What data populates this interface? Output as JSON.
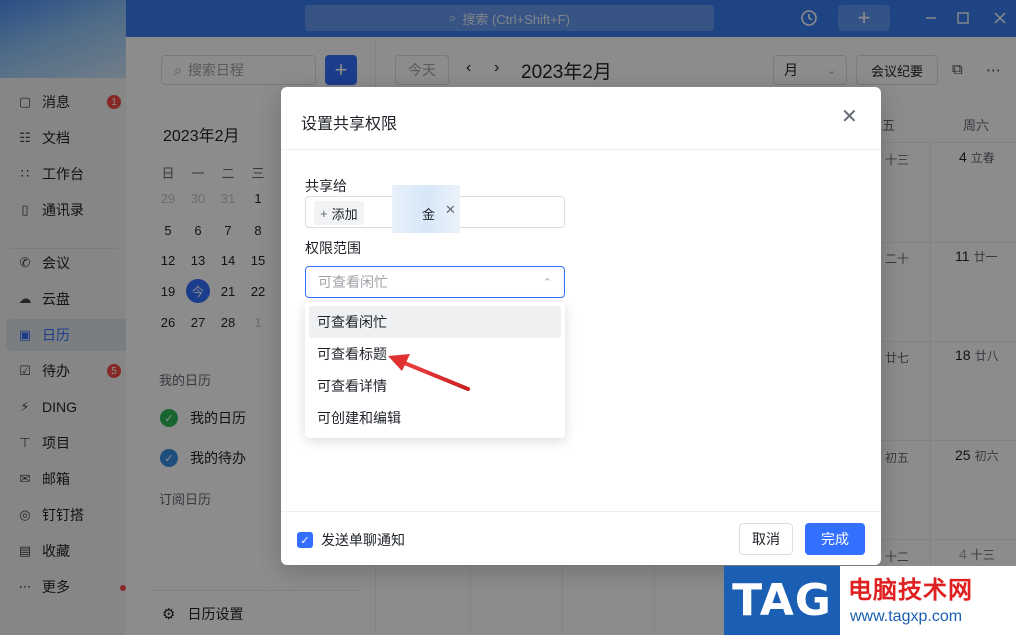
{
  "titlebar": {
    "search_placeholder": "搜索 (Ctrl+Shift+F)",
    "icons": [
      "history-icon",
      "plus-icon",
      "minimize-icon",
      "maximize-icon",
      "close-icon"
    ]
  },
  "sidebar": {
    "items": [
      {
        "label": "消息",
        "icon": "message-icon",
        "badge": "1"
      },
      {
        "label": "文档",
        "icon": "document-icon"
      },
      {
        "label": "工作台",
        "icon": "apps-icon"
      },
      {
        "label": "通讯录",
        "icon": "contacts-icon"
      },
      {
        "label": "会议",
        "icon": "phone-icon"
      },
      {
        "label": "云盘",
        "icon": "cloud-icon"
      },
      {
        "label": "日历",
        "icon": "calendar-icon",
        "active": true
      },
      {
        "label": "待办",
        "icon": "todo-icon",
        "badge": "5"
      },
      {
        "label": "DING",
        "icon": "lightning-icon"
      },
      {
        "label": "项目",
        "icon": "project-icon"
      },
      {
        "label": "邮箱",
        "icon": "mail-icon"
      },
      {
        "label": "钉钉搭",
        "icon": "builder-icon"
      },
      {
        "label": "收藏",
        "icon": "favorite-icon"
      },
      {
        "label": "更多",
        "icon": "more-icon",
        "dot": true
      }
    ]
  },
  "cal_panel": {
    "search_placeholder": "搜索日程",
    "mini_month": "2023年2月",
    "weekday_headers": [
      "日",
      "一",
      "二",
      "三"
    ],
    "rows": [
      [
        "29",
        "30",
        "31",
        "1"
      ],
      [
        "5",
        "6",
        "7",
        "8"
      ],
      [
        "12",
        "13",
        "14",
        "15"
      ],
      [
        "19",
        "今",
        "21",
        "22"
      ],
      [
        "26",
        "27",
        "28",
        "1"
      ]
    ],
    "my_calendars_title": "我的日历",
    "my_calendar": "我的日历",
    "my_todo": "我的待办",
    "subscribed_title": "订阅日历",
    "settings_label": "日历设置"
  },
  "main": {
    "today_label": "今天",
    "month_title": "2023年2月",
    "view_label": "月",
    "notes_label": "会议纪要",
    "week_headers": [
      "五",
      "周六"
    ],
    "cells": {
      "fri": [
        "十三",
        "二十",
        "廿七",
        "初五",
        "十二"
      ],
      "sat_num": [
        "4",
        "11",
        "18",
        "25",
        "4"
      ],
      "sat_lunar": [
        "立春",
        "廿一",
        "廿八",
        "初六",
        "十三"
      ]
    }
  },
  "modal": {
    "title": "设置共享权限",
    "share_label": "共享给",
    "add_label": "添加",
    "partial_name": "金",
    "scope_label": "权限范围",
    "scope_placeholder": "可查看闲忙",
    "options": [
      "可查看闲忙",
      "可查看标题",
      "可查看详情",
      "可创建和编辑"
    ],
    "notify_label": "发送单聊通知",
    "cancel_label": "取消",
    "done_label": "完成"
  },
  "watermark": {
    "tag": "TAG",
    "title": "电脑技术网",
    "url": "www.tagxp.com"
  },
  "colors": {
    "accent": "#3370ff",
    "titlebar": "#3a7df0",
    "badge": "#f54a45",
    "annotation": "#e03030"
  }
}
